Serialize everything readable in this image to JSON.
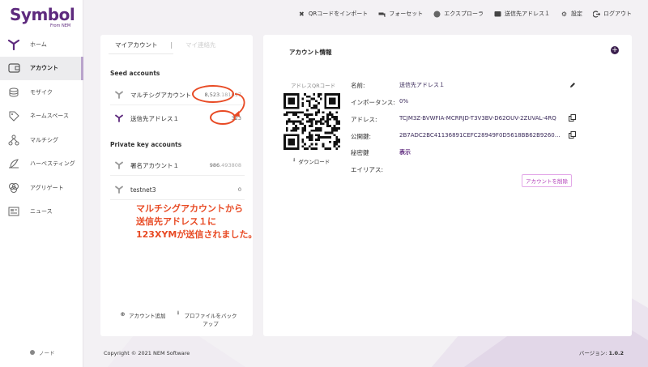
{
  "brand": {
    "name": "Symbol",
    "subtitle": "From NEM"
  },
  "topbar": [
    {
      "label": "QRコードをインポート",
      "icon": "qr-import-icon"
    },
    {
      "label": "フォーセット",
      "icon": "faucet-icon"
    },
    {
      "label": "エクスプローラ",
      "icon": "explorer-icon"
    },
    {
      "label": "送信先アドレス１",
      "icon": "wallet-icon"
    },
    {
      "label": "設定",
      "icon": "gear-icon"
    },
    {
      "label": "ログアウト",
      "icon": "logout-icon"
    }
  ],
  "sidebar": {
    "items": [
      {
        "label": "ホーム",
        "icon": "home-icon",
        "active": false
      },
      {
        "label": "アカウント",
        "icon": "account-icon",
        "active": true
      },
      {
        "label": "モザイク",
        "icon": "mosaic-icon",
        "active": false
      },
      {
        "label": "ネームスペース",
        "icon": "namespace-icon",
        "active": false
      },
      {
        "label": "マルチシグ",
        "icon": "multisig-icon",
        "active": false
      },
      {
        "label": "ハーベスティング",
        "icon": "harvesting-icon",
        "active": false
      },
      {
        "label": "アグリゲート",
        "icon": "aggregate-icon",
        "active": false
      },
      {
        "label": "ニュース",
        "icon": "news-icon",
        "active": false
      }
    ],
    "node_label": "ノード"
  },
  "left_panel": {
    "tabs": [
      "マイアカウント",
      "マイ連絡先"
    ],
    "seed_title": "Seed accounts",
    "seed_accounts": [
      {
        "name": "マルチシグアカウント",
        "balance_int": "8,523",
        "balance_frac": ".181617"
      },
      {
        "name": "送信先アドレス１",
        "balance_int": "323",
        "balance_frac": ""
      }
    ],
    "pk_title": "Private key accounts",
    "pk_accounts": [
      {
        "name": "署名アカウント１",
        "balance_int": "986",
        "balance_frac": ".493808"
      },
      {
        "name": "testnet3",
        "balance_int": "0",
        "balance_frac": ""
      }
    ],
    "add_account": "アカウント追加",
    "backup_profile_line1": "プロファイルをバック",
    "backup_profile_line2": "アップ"
  },
  "annotation": {
    "line1": "マルチシグアカウントから",
    "line2": "送信先アドレス１に",
    "line3": "123XYMが送信されました。",
    "color": "#e84a24"
  },
  "right_panel": {
    "title": "アカウント情報",
    "qr_label": "アドレスQRコード",
    "download": "ダウンロード",
    "fields": {
      "name_label": "名前:",
      "name_value": "送信先アドレス１",
      "importance_label": "インポータンス:",
      "importance_value": "0%",
      "address_label": "アドレス:",
      "address_value": "TCJM3Z-BVWFIA-MCRRJD-T3V3BV-D62OUV-2ZUVAL-4RQ",
      "pubkey_label": "公開鍵:",
      "pubkey_value": "2B7ADC2BC41136891CEFC28949F0D5618BB62B92606A0F...",
      "privkey_label": "秘密鍵",
      "privkey_value": "表示",
      "alias_label": "エイリアス:",
      "alias_value": ""
    },
    "delete_button": "アカウントを削除"
  },
  "footer": {
    "copyright": "Copyright © 2021 NEM Software",
    "version_label": "バージョン: ",
    "version_value": "1.0.2"
  },
  "colors": {
    "brand": "#5e2a7e",
    "annotation": "#e84a24",
    "delete": "#b03cb7"
  }
}
